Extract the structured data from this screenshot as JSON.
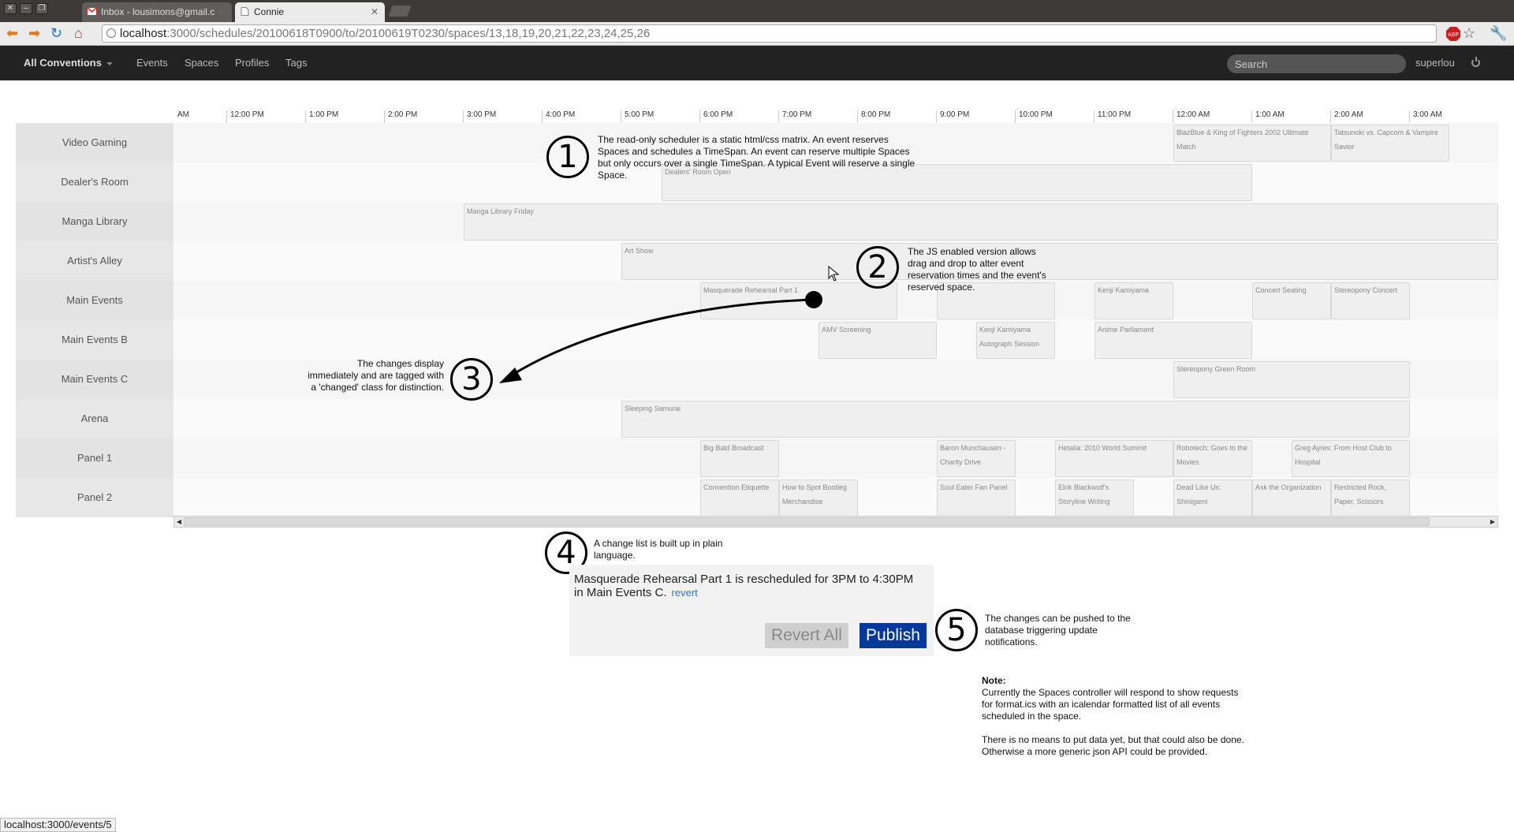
{
  "browser": {
    "tabs": [
      {
        "title": "Inbox - lousimons@gmail.c",
        "icon": "gmail-icon"
      },
      {
        "title": "Connie",
        "icon": "page-icon"
      }
    ],
    "url_host": "localhost",
    "url_path": ":3000/schedules/20100618T0900/to/20100619T0230/spaces/13,18,19,20,21,22,23,24,25,26",
    "status_url": "localhost:3000/events/5"
  },
  "navbar": {
    "brand": "All Conventions",
    "links": [
      "Events",
      "Spaces",
      "Profiles",
      "Tags"
    ],
    "search_placeholder": "Search",
    "user": "superlou"
  },
  "timeline": [
    "AM",
    "12:00 PM",
    "1:00 PM",
    "2:00 PM",
    "3:00 PM",
    "4:00 PM",
    "5:00 PM",
    "6:00 PM",
    "7:00 PM",
    "8:00 PM",
    "9:00 PM",
    "10:00 PM",
    "11:00 PM",
    "12:00 AM",
    "1:00 AM",
    "2:00 AM",
    "3:00 AM"
  ],
  "spaces": [
    "Video Gaming",
    "Dealer's Room",
    "Manga Library",
    "Artist's Alley",
    "Main Events",
    "Main Events B",
    "Main Events C",
    "Arena",
    "Panel 1",
    "Panel 2"
  ],
  "events": [
    {
      "row": 0,
      "title": "BlazBlue & King of Fighters 2002 Ultimate Match"
    },
    {
      "row": 0,
      "title": "Tatsunoki vs. Capcom & Vampire Savior"
    },
    {
      "row": 1,
      "title": "Dealers' Room Open"
    },
    {
      "row": 2,
      "title": "Manga Library Friday"
    },
    {
      "row": 3,
      "title": "Art Show"
    },
    {
      "row": 4,
      "title": "Masquerade Rehearsal Part 1"
    },
    {
      "row": 4,
      "title": ""
    },
    {
      "row": 4,
      "title": "Kenji Kamiyama"
    },
    {
      "row": 4,
      "title": "Concert Seating"
    },
    {
      "row": 4,
      "title": "Stereopony Concert"
    },
    {
      "row": 5,
      "title": "AMV Screening"
    },
    {
      "row": 5,
      "title": "Kenji Kamiyama Autograph Session"
    },
    {
      "row": 5,
      "title": "Anime Parliament"
    },
    {
      "row": 6,
      "title": "Stereopony Green Room"
    },
    {
      "row": 7,
      "title": "Sleeping Samurai"
    },
    {
      "row": 8,
      "title": "Big Bald Broadcast"
    },
    {
      "row": 8,
      "title": "Baron Munchausen - Charity Drive"
    },
    {
      "row": 8,
      "title": "Hetalia: 2010 World Summit"
    },
    {
      "row": 8,
      "title": "Robotech: Goes to the Movies"
    },
    {
      "row": 8,
      "title": "Greg Ayres: From Host Club to Hospital"
    },
    {
      "row": 9,
      "title": "Convention Etiquette"
    },
    {
      "row": 9,
      "title": "How to Spot Bootleg Merchandise"
    },
    {
      "row": 9,
      "title": "Soul Eater Fan Panel"
    },
    {
      "row": 9,
      "title": "Elrik Blackwolf's Storyline Writing"
    },
    {
      "row": 9,
      "title": "Dead Like Us: Shinigami"
    },
    {
      "row": 9,
      "title": "Ask the Organization"
    },
    {
      "row": 9,
      "title": "Restricted Rock, Paper, Scissors"
    }
  ],
  "annotations": {
    "n1": "1",
    "t1": "The read-only scheduler is a static html/css matrix. An event reserves Spaces and schedules a TimeSpan.  An event can reserve multiple Spaces but only occurs over a single TimeSpan.  A typical Event will reserve a single Space.",
    "n2": "2",
    "t2": "The JS enabled version allows drag and drop to alter event reservation times and the event's reserved space.",
    "n3": "3",
    "t3": "The changes display immediately and are tagged with a 'changed' class for distinction.",
    "n4": "4",
    "t4": "A change list is built up in plain language.",
    "n5": "5",
    "t5": "The changes can be pushed to the database triggering update notifications.",
    "note_title": "Note:",
    "note_p1": "Currently the Spaces controller will respond to show requests for format.ics with an icalendar formatted list of all events scheduled in the space.",
    "note_p2": "There is no means to put data yet, but that could also be done.  Otherwise a more generic json API could be provided."
  },
  "change_list": {
    "text": "Masquerade Rehearsal Part 1 is rescheduled for 3PM to 4:30PM in Main Events C.",
    "revert_label": "revert",
    "revert_all_label": "Revert All",
    "publish_label": "Publish"
  }
}
